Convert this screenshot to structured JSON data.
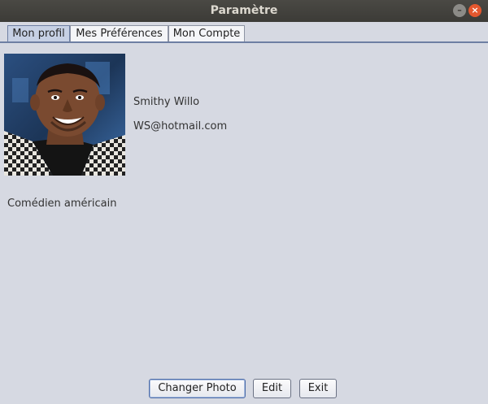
{
  "window": {
    "title": "Paramètre",
    "minimize_label": "–",
    "close_label": "×"
  },
  "tabs": [
    {
      "label": "Mon profil",
      "active": true
    },
    {
      "label": "Mes Préférences",
      "active": false
    },
    {
      "label": "Mon Compte",
      "active": false
    }
  ],
  "profile": {
    "name": "Smithy Willo",
    "email": "WS@hotmail.com",
    "description": "Comédien américain"
  },
  "buttons": {
    "change_photo": "Changer Photo",
    "edit": "Edit",
    "exit": "Exit"
  },
  "colors": {
    "titlebar": "#3c3b37",
    "background": "#d6d9e2",
    "tab_active": "#c6d0e4",
    "close_button": "#e4572e"
  }
}
